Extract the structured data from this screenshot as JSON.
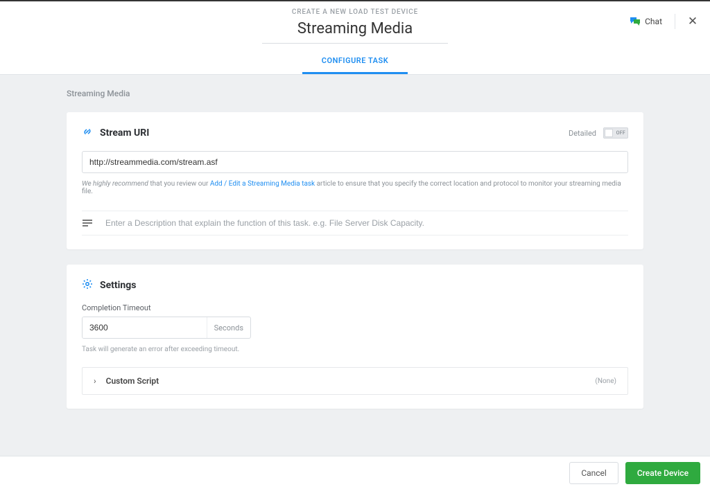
{
  "header": {
    "breadcrumb": "CREATE A NEW LOAD TEST DEVICE",
    "title": "Streaming Media",
    "chat_label": "Chat",
    "tab_label": "CONFIGURE TASK"
  },
  "section_label": "Streaming Media",
  "stream_uri_card": {
    "title": "Stream URI",
    "detailed_label": "Detailed",
    "toggle_state": "OFF",
    "uri_value": "http://streammedia.com/stream.asf",
    "helper_prefix_italic": "We highly recommend",
    "helper_middle": " that you review our ",
    "helper_link": "Add / Edit a Streaming Media task",
    "helper_suffix": " article to ensure that you specify the correct location and protocol to monitor your streaming media file.",
    "description_placeholder": "Enter a Description that explain the function of this task. e.g. File Server Disk Capacity."
  },
  "settings_card": {
    "title": "Settings",
    "timeout_label": "Completion Timeout",
    "timeout_value": "3600",
    "timeout_suffix": "Seconds",
    "timeout_helper": "Task will generate an error after exceeding timeout.",
    "custom_script_title": "Custom Script",
    "custom_script_badge": "(None)"
  },
  "footer": {
    "cancel": "Cancel",
    "create": "Create Device"
  }
}
